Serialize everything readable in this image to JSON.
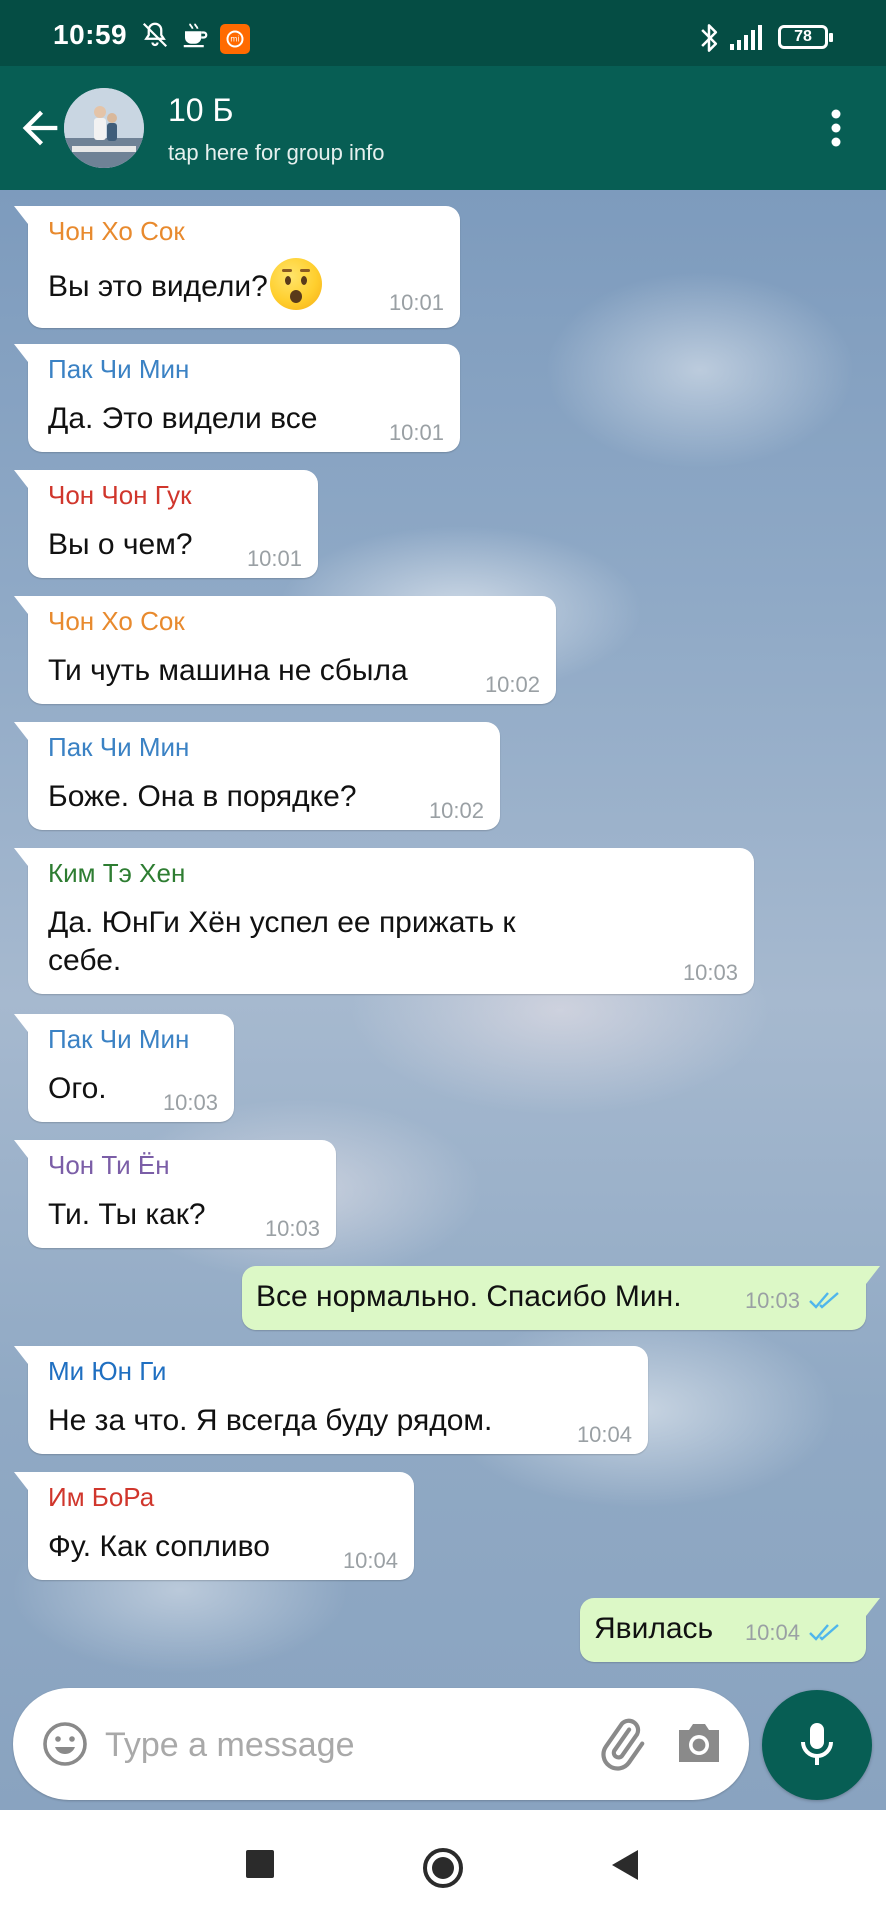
{
  "status_bar": {
    "time": "10:59",
    "battery": "78",
    "icons": [
      "bell-off-icon",
      "coffee-icon",
      "app-notification-icon",
      "bluetooth-icon",
      "signal-icon",
      "battery-icon"
    ]
  },
  "header": {
    "title": "10 Б",
    "subtitle": "tap here for group info",
    "icons": [
      "back-arrow-icon",
      "group-avatar",
      "more-vert-icon"
    ]
  },
  "messages": [
    {
      "direction": "in",
      "sender": "Чон Хо Сок",
      "sender_color": "#e88a2e",
      "text": "Вы это видели?",
      "emoji": "hushed-face",
      "time": "10:01"
    },
    {
      "direction": "in",
      "sender": "Пак Чи Мин",
      "sender_color": "#3b82c4",
      "text": "Да. Это видели все",
      "time": "10:01"
    },
    {
      "direction": "in",
      "sender": "Чон Чон Гук",
      "sender_color": "#d0362c",
      "text": "Вы о чем?",
      "time": "10:01"
    },
    {
      "direction": "in",
      "sender": "Чон Хо Сок",
      "sender_color": "#e88a2e",
      "text": "Ти чуть машина не сбыла",
      "time": "10:02"
    },
    {
      "direction": "in",
      "sender": "Пак Чи Мин",
      "sender_color": "#3b82c4",
      "text": "Боже. Она в порядке?",
      "time": "10:02"
    },
    {
      "direction": "in",
      "sender": "Ким Тэ Хен",
      "sender_color": "#2e7d32",
      "text": "Да. ЮнГи Хён успел ее прижать к себе.",
      "time": "10:03"
    },
    {
      "direction": "in",
      "sender": "Пак Чи Мин",
      "sender_color": "#3b82c4",
      "text": "Ого.",
      "time": "10:03"
    },
    {
      "direction": "in",
      "sender": "Чон Ти Ён",
      "sender_color": "#7b5ea7",
      "text": "Ти. Ты как?",
      "time": "10:03"
    },
    {
      "direction": "out",
      "text": "Все нормально. Спасибо Мин.",
      "time": "10:03",
      "status": "read"
    },
    {
      "direction": "in",
      "sender": "Ми Юн Ги",
      "sender_color": "#1f6fc1",
      "text": "Не за что. Я всегда буду рядом.",
      "time": "10:04"
    },
    {
      "direction": "in",
      "sender": "Им БоРа",
      "sender_color": "#d0362c",
      "text": "Фу. Как сопливо",
      "time": "10:04"
    },
    {
      "direction": "out",
      "text": "Явилась",
      "time": "10:04",
      "status": "read"
    }
  ],
  "composer": {
    "placeholder": "Type a message",
    "icons": [
      "emoji-icon",
      "attach-icon",
      "camera-icon",
      "mic-icon"
    ]
  },
  "nav_bar": {
    "icons": [
      "recents-square-icon",
      "home-circle-icon",
      "back-triangle-icon"
    ]
  },
  "colors": {
    "header": "#075e54",
    "status_bar": "#054d44",
    "outgoing_bubble": "#dcf8c6",
    "incoming_bubble": "#ffffff",
    "read_ticks": "#4fb6ec",
    "timestamp": "#9aa0a4"
  }
}
